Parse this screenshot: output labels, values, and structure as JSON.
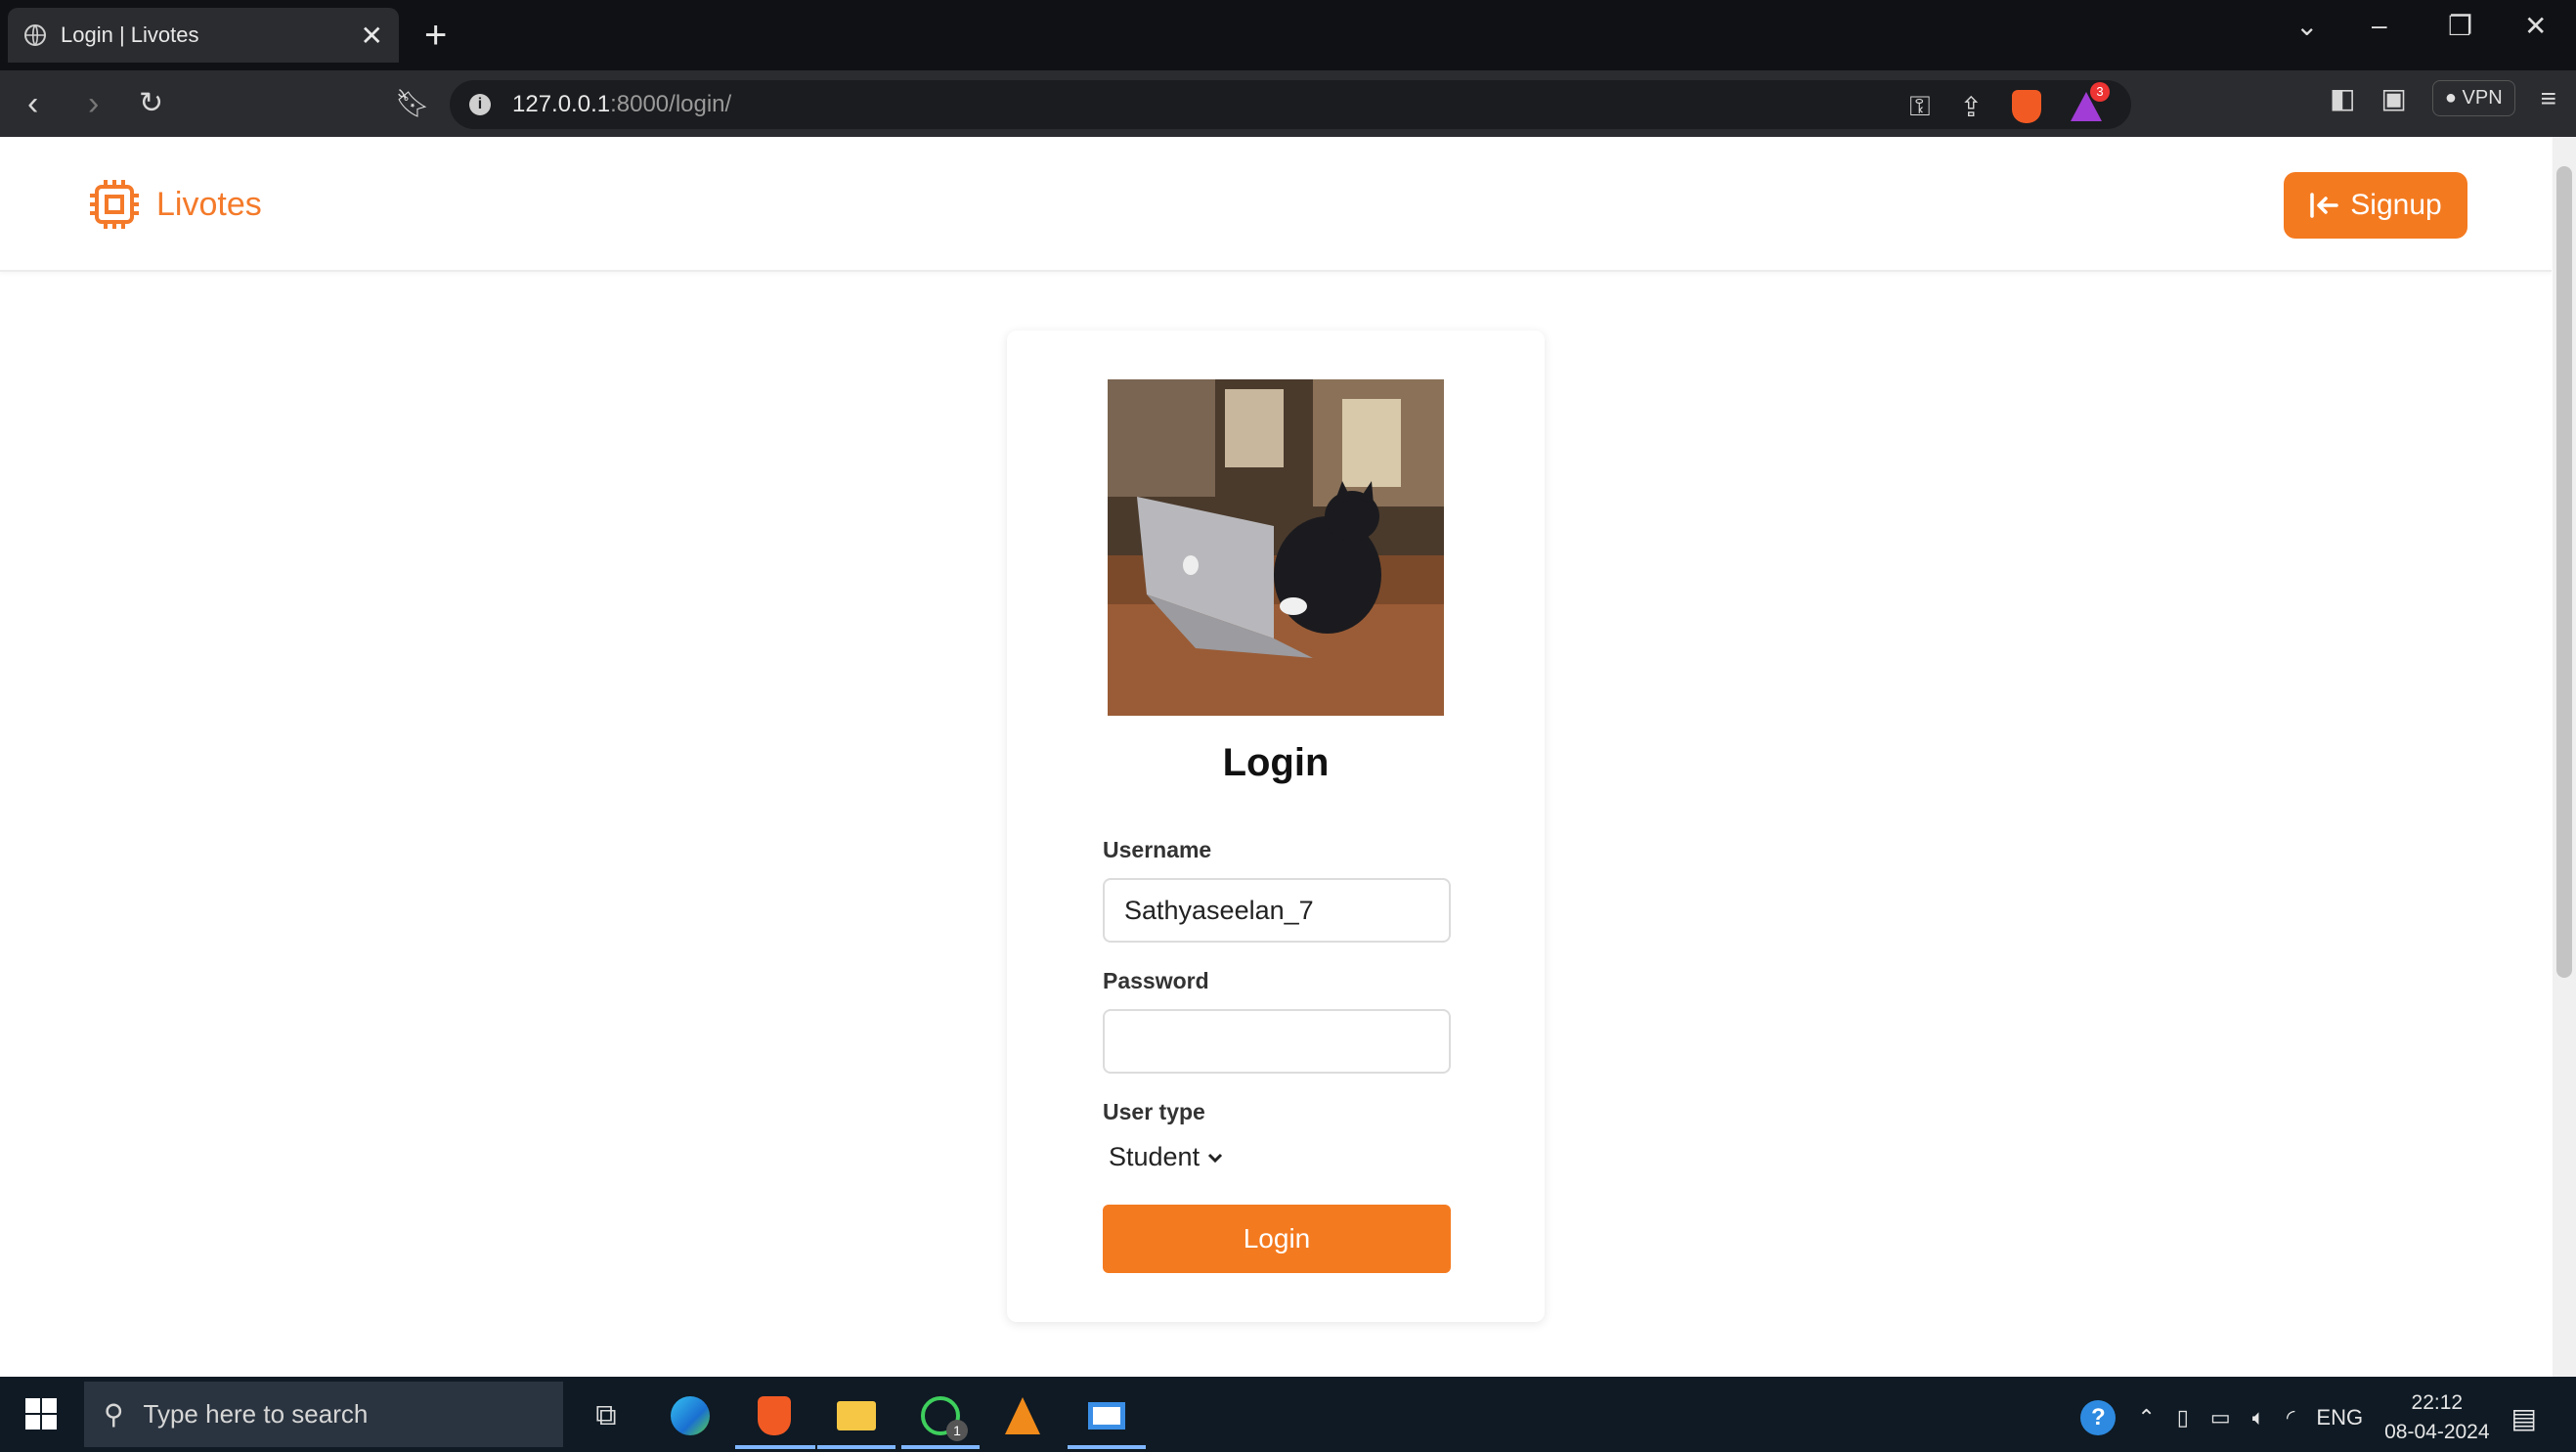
{
  "browser": {
    "tab_title": "Login | Livotes",
    "url_host": "127.0.0.1",
    "url_path": ":8000/login/",
    "vpn_label": "VPN",
    "notification_count": "3"
  },
  "navbar": {
    "brand": "Livotes",
    "signup_label": "Signup"
  },
  "login": {
    "title": "Login",
    "username_label": "Username",
    "username_value": "Sathyaseelan_7",
    "password_label": "Password",
    "password_value": "",
    "user_type_label": "User type",
    "user_type_selected": "Student",
    "submit_label": "Login"
  },
  "taskbar": {
    "search_placeholder": "Type here to search",
    "language": "ENG",
    "time": "22:12",
    "date": "08-04-2024",
    "whatsapp_badge": "1"
  },
  "colors": {
    "accent": "#f47a1f"
  }
}
